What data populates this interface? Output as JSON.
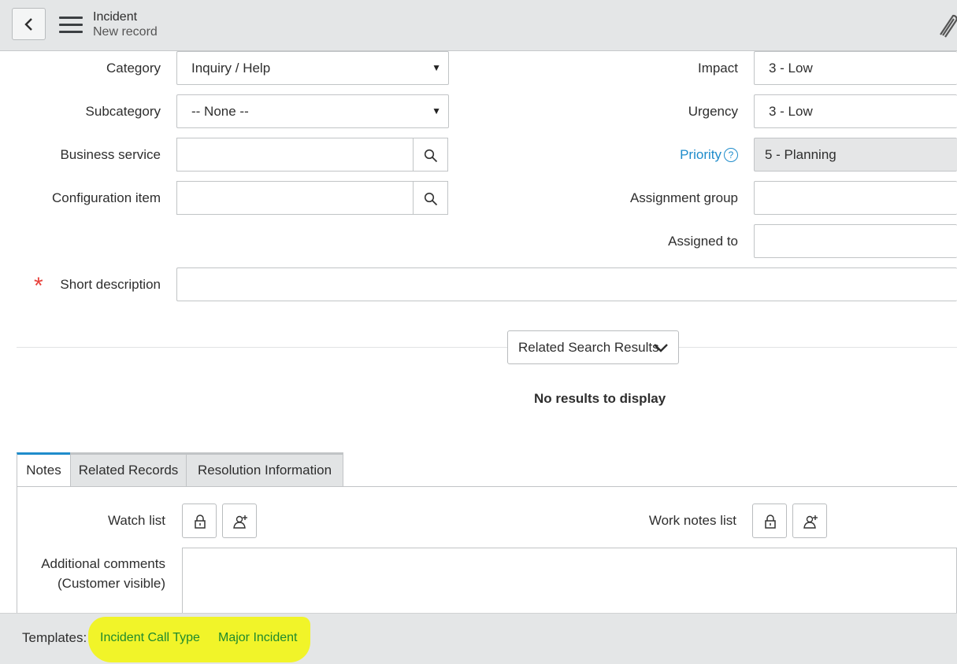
{
  "header": {
    "title": "Incident",
    "subtitle": "New record"
  },
  "form": {
    "category": {
      "label": "Category",
      "value": "Inquiry / Help"
    },
    "subcategory": {
      "label": "Subcategory",
      "value": "-- None --"
    },
    "business_service": {
      "label": "Business service",
      "value": ""
    },
    "configuration_item": {
      "label": "Configuration item",
      "value": ""
    },
    "impact": {
      "label": "Impact",
      "value": "3 - Low"
    },
    "urgency": {
      "label": "Urgency",
      "value": "3 - Low"
    },
    "priority": {
      "label": "Priority",
      "help": "?",
      "value": "5 - Planning"
    },
    "assignment_group": {
      "label": "Assignment group",
      "value": ""
    },
    "assigned_to": {
      "label": "Assigned to",
      "value": ""
    },
    "short_description": {
      "label": "Short description",
      "required_mark": "*",
      "value": ""
    }
  },
  "related_search": {
    "button_label": "Related Search Results",
    "empty_text": "No results to display"
  },
  "tabs": [
    {
      "label": "Notes",
      "active": true
    },
    {
      "label": "Related Records",
      "active": false
    },
    {
      "label": "Resolution Information",
      "active": false
    }
  ],
  "notes": {
    "watch_list_label": "Watch list",
    "work_notes_list_label": "Work notes list",
    "additional_comments_label_1": "Additional comments",
    "additional_comments_label_2": "(Customer visible)"
  },
  "footer": {
    "templates_label": "Templates:",
    "templates": [
      "Incident Call Type",
      "Major Incident"
    ]
  },
  "colors": {
    "link_blue": "#1f8ccb",
    "required_red": "#e8413b",
    "highlight": "#f1f429",
    "template_green": "#1e8a2e"
  }
}
